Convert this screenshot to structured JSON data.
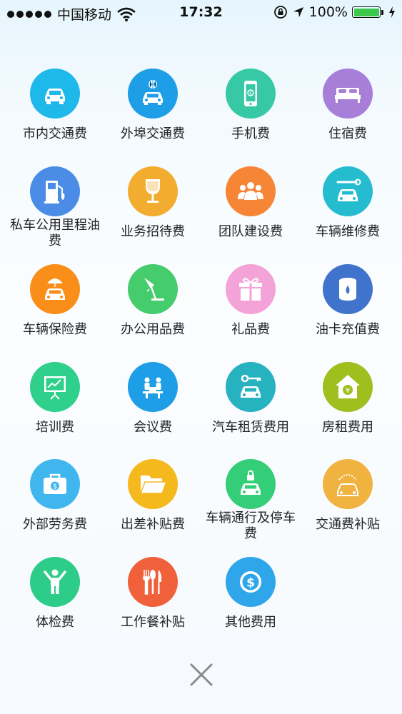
{
  "status_bar": {
    "carrier": "中国移动",
    "time": "17:32",
    "battery_percent": "100%",
    "battery_level": 1.0,
    "icons": [
      "signal-dots-icon",
      "wifi-icon",
      "rotation-lock-icon",
      "location-arrow-icon",
      "battery-icon",
      "charging-bolt-icon"
    ]
  },
  "categories": [
    {
      "label": "市内交通费",
      "icon": "car-icon",
      "color": "#1fb8ea"
    },
    {
      "label": "外埠交通费",
      "icon": "car-globe-icon",
      "color": "#1e9ee6"
    },
    {
      "label": "手机费",
      "icon": "mobile-phone-icon",
      "color": "#37c9a6"
    },
    {
      "label": "住宿费",
      "icon": "bed-icon",
      "color": "#a77ed8"
    },
    {
      "label": "私车公用里程油费",
      "icon": "fuel-pump-icon",
      "color": "#4b8de6"
    },
    {
      "label": "业务招待费",
      "icon": "wine-glass-icon",
      "color": "#f2ad30"
    },
    {
      "label": "团队建设费",
      "icon": "team-icon",
      "color": "#f78536"
    },
    {
      "label": "车辆维修费",
      "icon": "car-wrench-icon",
      "color": "#26bcd0"
    },
    {
      "label": "车辆保险费",
      "icon": "car-umbrella-icon",
      "color": "#f98e19"
    },
    {
      "label": "办公用品费",
      "icon": "desk-lamp-icon",
      "color": "#45cc6d"
    },
    {
      "label": "礼品费",
      "icon": "gift-icon",
      "color": "#f3a3d8"
    },
    {
      "label": "油卡充值费",
      "icon": "oil-drum-icon",
      "color": "#3f73cc"
    },
    {
      "label": "培训费",
      "icon": "presentation-board-icon",
      "color": "#2fcf8c"
    },
    {
      "label": "会议费",
      "icon": "meeting-icon",
      "color": "#1e9ee6"
    },
    {
      "label": "汽车租赁费用",
      "icon": "car-key-icon",
      "color": "#27b2c0"
    },
    {
      "label": "房租费用",
      "icon": "house-yuan-icon",
      "color": "#9fbf1f"
    },
    {
      "label": "外部劳务费",
      "icon": "briefcase-dollar-icon",
      "color": "#3fb7ee"
    },
    {
      "label": "出差补贴费",
      "icon": "folder-icon",
      "color": "#f6b91d"
    },
    {
      "label": "车辆通行及停车费",
      "icon": "car-lock-icon",
      "color": "#34cd78"
    },
    {
      "label": "交通费补贴",
      "icon": "car-sun-icon",
      "color": "#f1b33f"
    },
    {
      "label": "体检费",
      "icon": "person-arms-up-icon",
      "color": "#2dcc88"
    },
    {
      "label": "工作餐补贴",
      "icon": "cutlery-icon",
      "color": "#f0603b"
    },
    {
      "label": "其他费用",
      "icon": "dollar-coin-icon",
      "color": "#2fa6ea"
    }
  ],
  "close": {
    "icon": "close-icon"
  }
}
